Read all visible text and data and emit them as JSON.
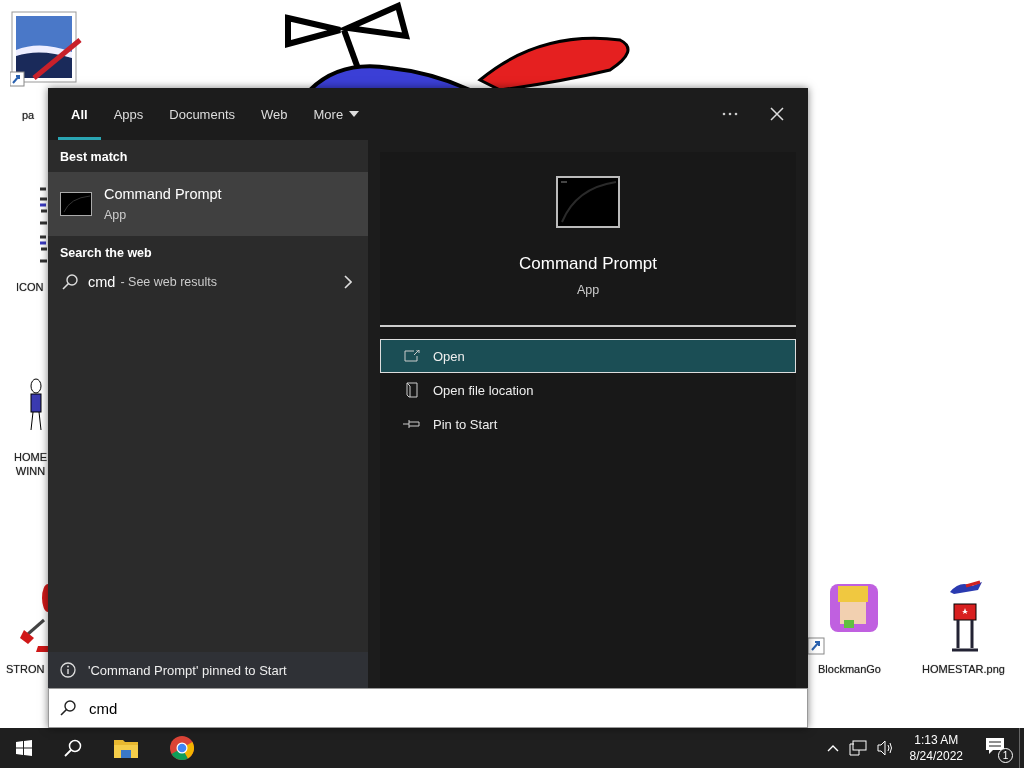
{
  "desktop_icons": [
    {
      "kind": "paint",
      "lines": [
        "pa"
      ]
    },
    {
      "kind": "sheet",
      "lines": [
        "ICON"
      ]
    },
    {
      "kind": "figure",
      "lines": [
        "HOME",
        "WINN"
      ]
    },
    {
      "kind": "strong",
      "lines": [
        "STRON"
      ]
    },
    {
      "kind": "game",
      "lines": [
        "BlockmanGo"
      ]
    },
    {
      "kind": "homestar",
      "lines": [
        "HOMESTAR.png"
      ]
    }
  ],
  "search_panel": {
    "tabs": [
      {
        "label": "All",
        "selected": true,
        "kind": "plain"
      },
      {
        "label": "Apps",
        "selected": false,
        "kind": "plain"
      },
      {
        "label": "Documents",
        "selected": false,
        "kind": "plain"
      },
      {
        "label": "Web",
        "selected": false,
        "kind": "plain"
      },
      {
        "label": "More",
        "selected": false,
        "kind": "dropdown"
      }
    ],
    "best_match": {
      "heading": "Best match",
      "title": "Command Prompt",
      "subtitle": "App",
      "selected": true
    },
    "web": {
      "heading": "Search the web",
      "query": "cmd",
      "suffix": "- See web results"
    },
    "notice": "'Command Prompt' pinned to Start",
    "preview": {
      "title": "Command Prompt",
      "subtitle": "App",
      "actions": [
        {
          "kind": "open",
          "label": "Open",
          "selected": true
        },
        {
          "kind": "location",
          "label": "Open file location",
          "selected": false
        },
        {
          "kind": "pin",
          "label": "Pin to Start",
          "selected": false
        }
      ]
    },
    "search_field": {
      "value": "cmd"
    }
  },
  "taskbar": {
    "time": "1:13 AM",
    "date": "8/24/2022",
    "notification_count": "1"
  }
}
